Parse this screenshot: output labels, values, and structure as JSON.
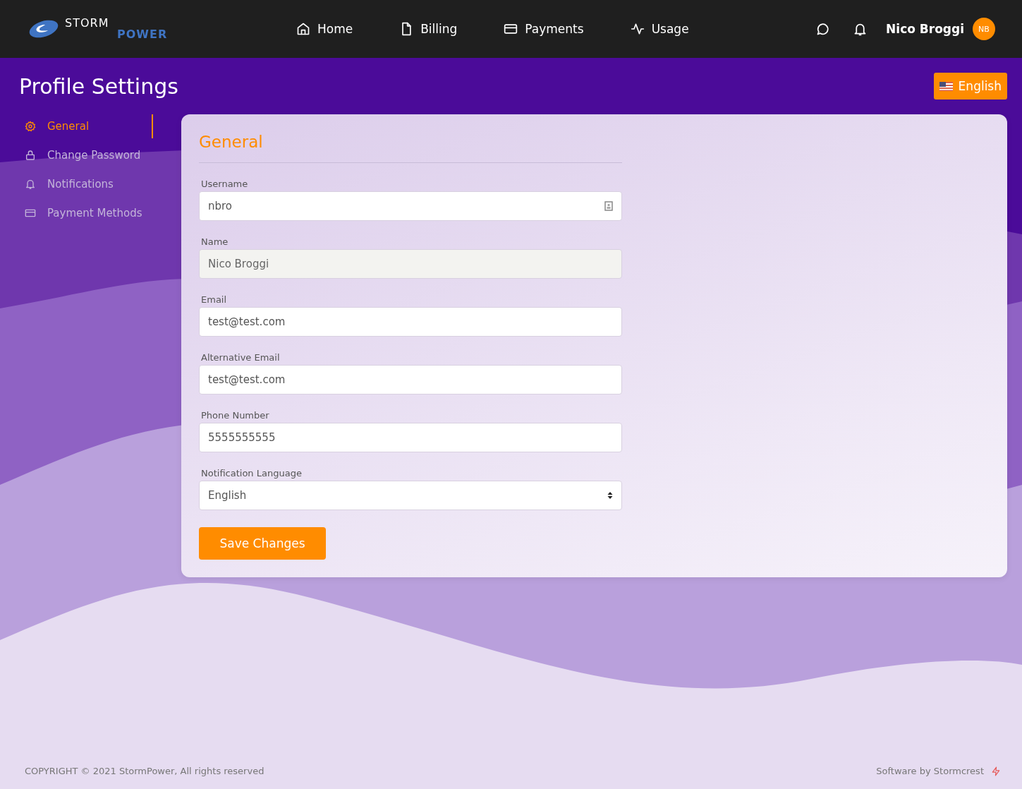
{
  "brand": {
    "line1": "STORM",
    "line2": "POWER"
  },
  "nav": [
    {
      "label": "Home",
      "selected": false
    },
    {
      "label": "Billing",
      "selected": false
    },
    {
      "label": "Payments",
      "selected": false
    },
    {
      "label": "Usage",
      "selected": false
    }
  ],
  "user": {
    "name": "Nico Broggi",
    "initials": "NB"
  },
  "page_title": "Profile Settings",
  "language_button": "English",
  "sidebar": {
    "items": [
      {
        "label": "General",
        "selected": true
      },
      {
        "label": "Change Password",
        "selected": false
      },
      {
        "label": "Notifications",
        "selected": false
      },
      {
        "label": "Payment Methods",
        "selected": false
      }
    ]
  },
  "form": {
    "title": "General",
    "fields": [
      {
        "label": "Username",
        "value": "nbro",
        "kind": "icon",
        "disabled": false
      },
      {
        "label": "Name",
        "value": "Nico Broggi",
        "kind": "text",
        "disabled": true
      },
      {
        "label": "Email",
        "value": "test@test.com",
        "kind": "text",
        "disabled": false
      },
      {
        "label": "Alternative Email",
        "value": "test@test.com",
        "kind": "text",
        "disabled": false
      },
      {
        "label": "Phone Number",
        "value": "5555555555",
        "kind": "text",
        "disabled": false
      },
      {
        "label": "Notification Language",
        "value": "English",
        "kind": "select",
        "disabled": false
      }
    ],
    "save_button": "Save Changes"
  },
  "footer": {
    "copyright": "COPYRIGHT © 2021 StormPower, All rights reserved",
    "credit": "Software by Stormcrest"
  }
}
